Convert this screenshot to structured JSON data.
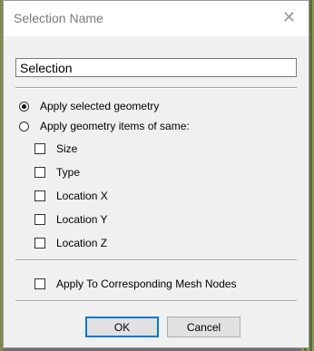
{
  "dialog": {
    "title": "Selection Name",
    "close_glyph": "✕",
    "name_value": "Selection",
    "radios": [
      {
        "label": "Apply selected geometry",
        "checked": true
      },
      {
        "label": "Apply geometry items of same:",
        "checked": false
      }
    ],
    "checkboxes": [
      {
        "label": "Size",
        "checked": false
      },
      {
        "label": "Type",
        "checked": false
      },
      {
        "label": "Location X",
        "checked": false
      },
      {
        "label": "Location Y",
        "checked": false
      },
      {
        "label": "Location Z",
        "checked": false
      }
    ],
    "mesh_checkbox": {
      "label": "Apply To Corresponding Mesh Nodes",
      "checked": false
    },
    "ok_label": "OK",
    "cancel_label": "Cancel"
  }
}
